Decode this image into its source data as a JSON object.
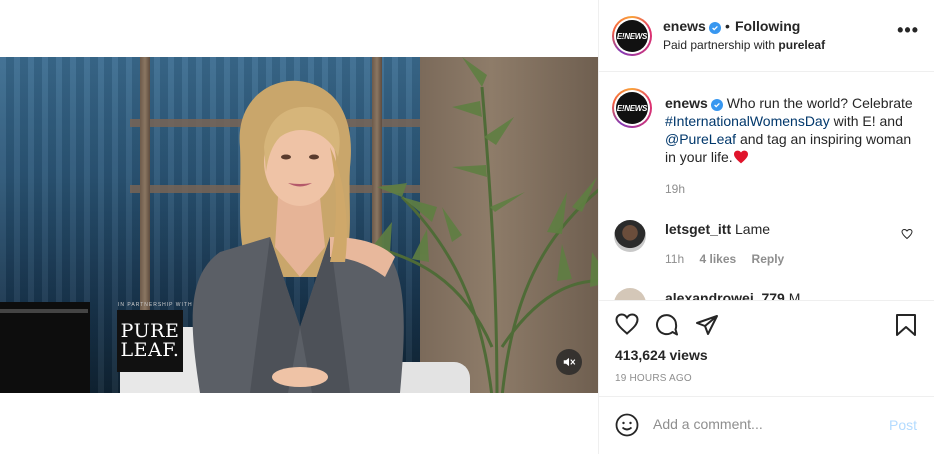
{
  "post": {
    "username": "enews",
    "follow_separator": "•",
    "follow_status": "Following",
    "partnership_prefix": "Paid partnership with",
    "partner": "pureleaf",
    "avatar_text": "E!NEWS",
    "more_label": "•••"
  },
  "media": {
    "overlay_small_text": "IN PARTNERSHIP WITH",
    "logo_line1": "PURE",
    "logo_line2": "LEAF.",
    "mute_icon": "speaker-muted-icon"
  },
  "caption": {
    "username": "enews",
    "text_1": "Who run the world? Celebrate",
    "hashtag": "#InternationalWomensDay",
    "text_2": "with E! and",
    "mention": "@PureLeaf",
    "text_3": "and tag an inspiring woman in your life.",
    "emoji": "red-heart",
    "time": "19h"
  },
  "comments": [
    {
      "username": "letsget_itt",
      "text": "Lame",
      "time": "11h",
      "likes": "4 likes",
      "reply": "Reply"
    },
    {
      "username": "alexandrowei_779",
      "text": "M"
    }
  ],
  "actions": {
    "icons": [
      "heart-icon",
      "comment-icon",
      "share-icon",
      "bookmark-icon"
    ],
    "views": "413,624 views",
    "posted_ago": "19 HOURS AGO"
  },
  "add_comment": {
    "placeholder": "Add a comment...",
    "post_label": "Post",
    "emoji_icon": "smiley-icon"
  },
  "colors": {
    "link": "#00376b",
    "verified": "#3897f0",
    "post_disabled": "#b3dbff",
    "muted_text": "#8e8e8e"
  }
}
